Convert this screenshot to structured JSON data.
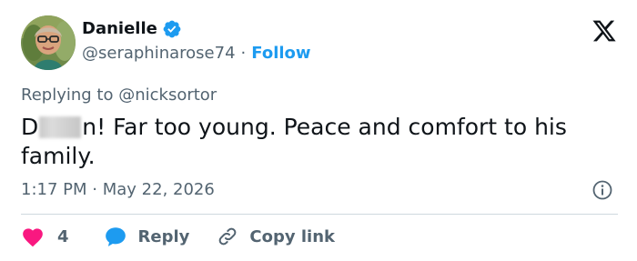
{
  "author": {
    "name": "Danielle",
    "handle": "@seraphinarose74",
    "separator": "·",
    "follow_label": "Follow",
    "verified": true
  },
  "brand": {
    "logo_icon": "x-logo-icon"
  },
  "reply_context": {
    "prefix": "Replying to",
    "mention": "@nicksortor"
  },
  "tweet": {
    "text_start": "D",
    "text_rest": "n! Far too young. Peace and comfort to his family.",
    "censored": true
  },
  "meta": {
    "time": "1:17 PM",
    "separator": "·",
    "date": "May 22, 2026"
  },
  "actions": {
    "like_count": "4",
    "reply_label": "Reply",
    "copy_link_label": "Copy link"
  },
  "colors": {
    "accent": "#1d9bf0",
    "like": "#f91880",
    "text": "#0f1419",
    "muted": "#536471",
    "divider": "#cfd9de"
  }
}
